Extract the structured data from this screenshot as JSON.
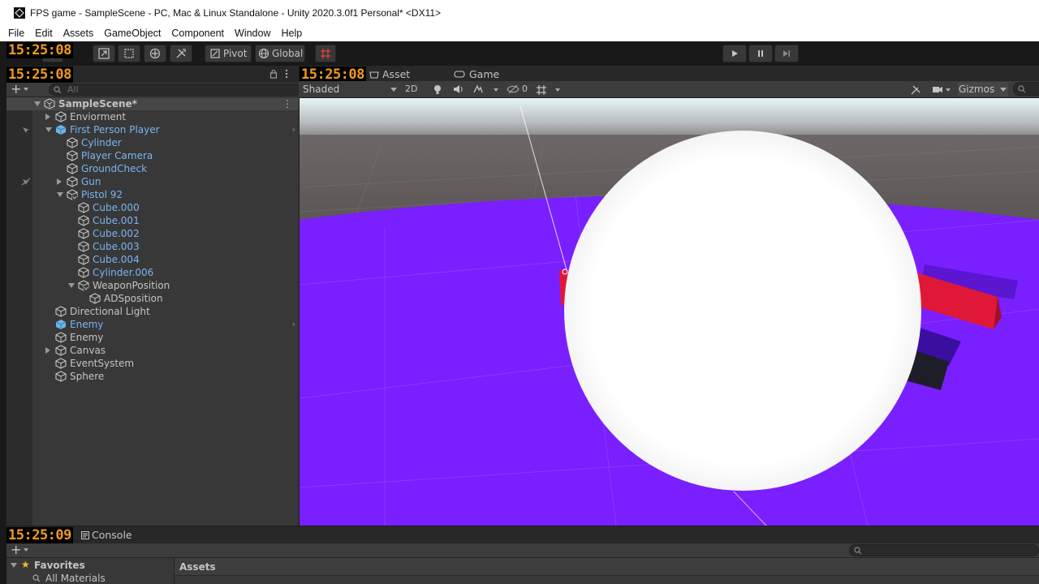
{
  "window": {
    "title": "FPS game - SampleScene - PC, Mac & Linux Standalone - Unity 2020.3.0f1 Personal* <DX11>"
  },
  "menu": [
    "File",
    "Edit",
    "Assets",
    "GameObject",
    "Component",
    "Window",
    "Help"
  ],
  "clocks": {
    "toolbar": "15:25:08",
    "hierarchy": "15:25:08",
    "scene": "15:25:08",
    "console": "15:25:09"
  },
  "toolbar": {
    "pivot_label": "Pivot",
    "global_label": "Global"
  },
  "hierarchy": {
    "search_placeholder": "All",
    "rows": [
      {
        "label": "SampleScene*",
        "depth": 0,
        "expand": "down",
        "icon": "unity-scene-icon",
        "type": "scene"
      },
      {
        "label": "Enviorment",
        "depth": 1,
        "expand": "right",
        "icon": "gameobject-icon",
        "type": "normal"
      },
      {
        "label": "First Person Player",
        "depth": 1,
        "expand": "down",
        "icon": "prefab-icon",
        "type": "prefab",
        "chevron": true
      },
      {
        "label": "Cylinder",
        "depth": 2,
        "expand": "none",
        "icon": "gameobject-icon",
        "type": "prefab"
      },
      {
        "label": "Player Camera",
        "depth": 2,
        "expand": "none",
        "icon": "gameobject-icon",
        "type": "prefab"
      },
      {
        "label": "GroundCheck",
        "depth": 2,
        "expand": "none",
        "icon": "gameobject-icon",
        "type": "prefab"
      },
      {
        "label": "Gun",
        "depth": 2,
        "expand": "right",
        "icon": "gameobject-icon",
        "type": "prefab"
      },
      {
        "label": "Pistol 92",
        "depth": 2,
        "expand": "down",
        "icon": "model-prefab-icon",
        "type": "prefab"
      },
      {
        "label": "Cube.000",
        "depth": 3,
        "expand": "none",
        "icon": "gameobject-icon",
        "type": "prefab"
      },
      {
        "label": "Cube.001",
        "depth": 3,
        "expand": "none",
        "icon": "gameobject-icon",
        "type": "prefab"
      },
      {
        "label": "Cube.002",
        "depth": 3,
        "expand": "none",
        "icon": "gameobject-icon",
        "type": "prefab"
      },
      {
        "label": "Cube.003",
        "depth": 3,
        "expand": "none",
        "icon": "gameobject-icon",
        "type": "prefab"
      },
      {
        "label": "Cube.004",
        "depth": 3,
        "expand": "none",
        "icon": "gameobject-icon",
        "type": "prefab"
      },
      {
        "label": "Cylinder.006",
        "depth": 3,
        "expand": "none",
        "icon": "gameobject-icon",
        "type": "prefab"
      },
      {
        "label": "WeaponPosition",
        "depth": 3,
        "expand": "down",
        "icon": "model-prefab-icon",
        "type": "normal"
      },
      {
        "label": "ADSposition",
        "depth": 4,
        "expand": "none",
        "icon": "gameobject-icon",
        "type": "normal"
      },
      {
        "label": "Directional Light",
        "depth": 1,
        "expand": "none",
        "icon": "gameobject-icon",
        "type": "normal"
      },
      {
        "label": "Enemy",
        "depth": 1,
        "expand": "none",
        "icon": "prefab-icon",
        "type": "prefab",
        "chevron": true
      },
      {
        "label": "Enemy",
        "depth": 1,
        "expand": "none",
        "icon": "gameobject-icon",
        "type": "normal"
      },
      {
        "label": "Canvas",
        "depth": 1,
        "expand": "right",
        "icon": "gameobject-icon",
        "type": "normal"
      },
      {
        "label": "EventSystem",
        "depth": 1,
        "expand": "none",
        "icon": "gameobject-icon",
        "type": "normal"
      },
      {
        "label": "Sphere",
        "depth": 1,
        "expand": "none",
        "icon": "gameobject-icon",
        "type": "normal"
      }
    ]
  },
  "scene": {
    "tabs": {
      "asset_store": "Asset Store",
      "game": "Game"
    },
    "shading_mode": "Shaded",
    "mode_2d": "2D",
    "hidden_count": "0",
    "gizmos_label": "Gizmos"
  },
  "console": {
    "tab_label": "Console"
  },
  "project": {
    "favorites_label": "Favorites",
    "all_materials_label": "All Materials",
    "assets_label": "Assets"
  },
  "colors": {
    "prefab_text": "#7ab5f0",
    "floor": "#7a1fff",
    "clock": "#f39a1d",
    "sphere": "#ffffff"
  }
}
